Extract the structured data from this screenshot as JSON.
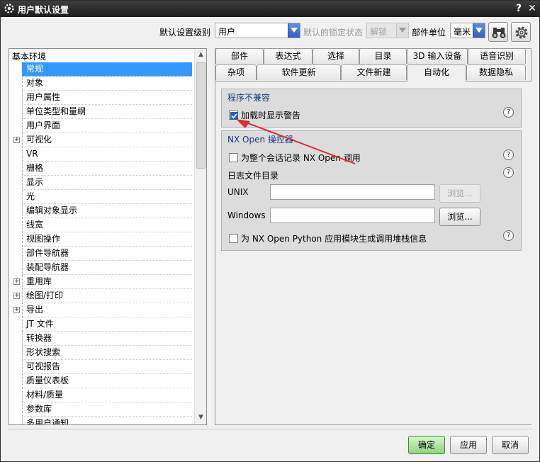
{
  "window": {
    "title": "用户默认设置",
    "help_glyph": "?",
    "close_glyph": "✕"
  },
  "toolbar": {
    "level_label": "默认设置级别",
    "level_value": "用户",
    "lock_label": "默认的锁定状态",
    "lock_value": "解锁",
    "unit_label": "部件单位",
    "unit_value": "毫米",
    "icons": [
      "binoculars-icon",
      "gear-icon"
    ]
  },
  "tree": {
    "root_label": "基本环境",
    "items": [
      {
        "label": "常规",
        "selected": true,
        "expandable": false
      },
      {
        "label": "对象",
        "expandable": false
      },
      {
        "label": "用户属性",
        "expandable": false
      },
      {
        "label": "单位类型和量纲",
        "expandable": false
      },
      {
        "label": "用户界面",
        "expandable": false
      },
      {
        "label": "可视化",
        "expandable": true
      },
      {
        "label": "VR",
        "expandable": false
      },
      {
        "label": "栅格",
        "expandable": false
      },
      {
        "label": "显示",
        "expandable": false
      },
      {
        "label": "光",
        "expandable": false
      },
      {
        "label": "编辑对象显示",
        "expandable": false
      },
      {
        "label": "线宽",
        "expandable": false
      },
      {
        "label": "视图操作",
        "expandable": false
      },
      {
        "label": "部件导航器",
        "expandable": false
      },
      {
        "label": "装配导航器",
        "expandable": false
      },
      {
        "label": "重用库",
        "expandable": true
      },
      {
        "label": "绘图/打印",
        "expandable": true
      },
      {
        "label": "导出",
        "expandable": true
      },
      {
        "label": "JT 文件",
        "expandable": false
      },
      {
        "label": "转换器",
        "expandable": false
      },
      {
        "label": "形状搜索",
        "expandable": false
      },
      {
        "label": "可视报告",
        "expandable": false
      },
      {
        "label": "质量仪表板",
        "expandable": false
      },
      {
        "label": "材料/质量",
        "expandable": false
      },
      {
        "label": "参数库",
        "expandable": false
      },
      {
        "label": "多用户通知",
        "expandable": false
      }
    ],
    "expand_glyph": "+"
  },
  "tabs": {
    "row1": [
      "部件",
      "表达式",
      "选择",
      "目录",
      "3D 输入设备",
      "语音识别"
    ],
    "row2": [
      "杂项",
      "软件更新",
      "文件新建",
      "自动化",
      "数据隐私"
    ],
    "active": "自动化"
  },
  "compat_group": {
    "title": "程序不兼容",
    "checkbox_label": "加载时显示警告",
    "checked": true
  },
  "nxopen_group": {
    "title": "NX Open 操控器",
    "record_label": "为整个会话记录 NX Open 调用",
    "record_checked": false,
    "log_dir_label": "日志文件目录",
    "unix_label": "UNIX",
    "unix_value": "",
    "windows_label": "Windows",
    "windows_value": "",
    "browse_label": "浏览...",
    "python_label": "为 NX Open Python 应用模块生成调用堆栈信息",
    "python_checked": false
  },
  "help_glyph": "?",
  "footer": {
    "ok_label": "确定",
    "apply_label": "应用",
    "cancel_label": "取消"
  },
  "colors": {
    "selection": "#3399ff",
    "annotation_arrow": "#e0293a",
    "ok_button": "#8fd27f"
  }
}
